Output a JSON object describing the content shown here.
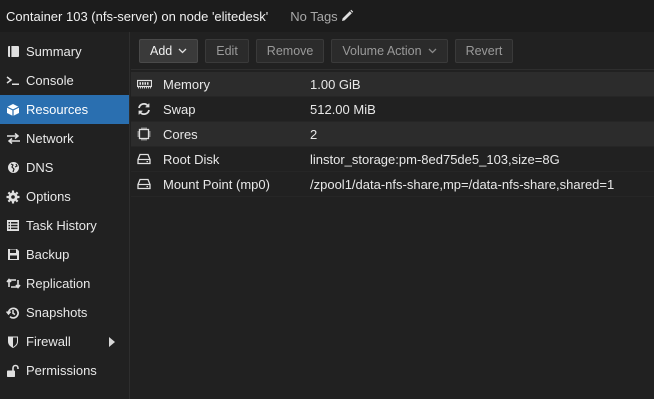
{
  "header": {
    "title": "Container 103 (nfs-server) on node 'elitedesk'",
    "tags_label": "No Tags"
  },
  "sidebar": {
    "items": [
      {
        "label": "Summary",
        "icon": "book-icon"
      },
      {
        "label": "Console",
        "icon": "terminal-icon"
      },
      {
        "label": "Resources",
        "icon": "cube-icon",
        "active": true
      },
      {
        "label": "Network",
        "icon": "exchange-icon"
      },
      {
        "label": "DNS",
        "icon": "globe-icon"
      },
      {
        "label": "Options",
        "icon": "gear-icon"
      },
      {
        "label": "Task History",
        "icon": "list-icon"
      },
      {
        "label": "Backup",
        "icon": "floppy-icon"
      },
      {
        "label": "Replication",
        "icon": "retweet-icon"
      },
      {
        "label": "Snapshots",
        "icon": "history-icon"
      },
      {
        "label": "Firewall",
        "icon": "shield-icon",
        "has_submenu": true
      },
      {
        "label": "Permissions",
        "icon": "unlock-icon"
      }
    ]
  },
  "toolbar": {
    "add_label": "Add",
    "edit_label": "Edit",
    "remove_label": "Remove",
    "volume_action_label": "Volume Action",
    "revert_label": "Revert"
  },
  "resources": [
    {
      "key": "Memory",
      "value": "1.00 GiB",
      "icon": "memory-icon"
    },
    {
      "key": "Swap",
      "value": "512.00 MiB",
      "icon": "refresh-icon"
    },
    {
      "key": "Cores",
      "value": "2",
      "icon": "cpu-icon"
    },
    {
      "key": "Root Disk",
      "value": "linstor_storage:pm-8ed75de5_103,size=8G",
      "icon": "hdd-icon"
    },
    {
      "key": "Mount Point (mp0)",
      "value": "/zpool1/data-nfs-share,mp=/data-nfs-share,shared=1",
      "icon": "hdd-icon"
    }
  ],
  "colors": {
    "accent": "#2a6fb0",
    "background": "#212121",
    "row_alt": "#2c2c2c"
  }
}
